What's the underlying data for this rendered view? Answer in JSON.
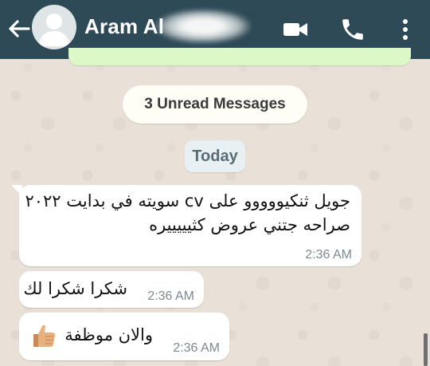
{
  "header": {
    "contact_name": "Aram Al",
    "icons": {
      "back": "arrow-left-icon",
      "avatar": "default-avatar-icon",
      "video": "video-camera-icon",
      "call": "phone-icon",
      "more": "more-vertical-icon"
    }
  },
  "chat": {
    "unread_banner": "3 Unread Messages",
    "date_chip": "Today",
    "messages": [
      {
        "lines": [
          "جويل ثنكيووووو على cv سويته في بدايت ٢٠٢٢",
          "صراحه جتني عروض كثيييييره"
        ],
        "time": "2:36 AM"
      },
      {
        "lines": [
          "شكرا شكرا لك"
        ],
        "time": "2:36 AM"
      },
      {
        "lines": [
          "والان موظفة"
        ],
        "emoji": "thumbs-up-icon",
        "time": "2:36 AM"
      }
    ]
  },
  "colors": {
    "header_bg": "#2d4a56",
    "incoming_bubble": "#ffffff",
    "outgoing_bubble": "#dcf8c6",
    "chat_bg": "#e9e1d8"
  }
}
